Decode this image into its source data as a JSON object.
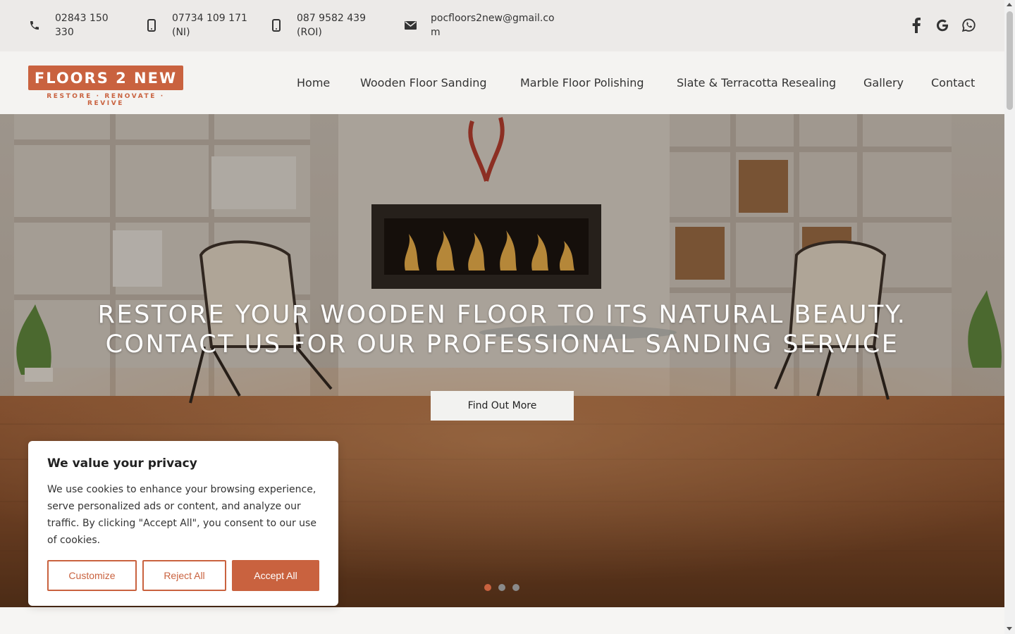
{
  "contact_bar": {
    "phone_landline": "02843 150 330",
    "mobile_ni": "07734 109 171 (NI)",
    "mobile_roi": "087 9582 439 (ROI)",
    "email": "pocfloors2new@gmail.com",
    "icons": [
      "phone-icon",
      "mobile-icon",
      "mobile-icon",
      "mail-icon"
    ],
    "social": [
      "facebook-icon",
      "google-icon",
      "whatsapp-icon"
    ]
  },
  "header": {
    "logo_text": "FLOORS 2 NEW",
    "logo_tagline": "RESTORE · RENOVATE · REVIVE",
    "nav": [
      "Home",
      "Wooden Floor Sanding",
      "Marble Floor Polishing",
      "Slate & Terracotta Resealing",
      "Gallery",
      "Contact"
    ]
  },
  "hero": {
    "title_line1": "RESTORE YOUR WOODEN FLOOR TO ITS NATURAL BEAUTY.",
    "title_line2": "CONTACT US FOR OUR PROFESSIONAL SANDING SERVICE",
    "button": "Find Out More",
    "slides": 3,
    "active_slide": 1
  },
  "cookie_banner": {
    "title": "We value your privacy",
    "text": "We use cookies to enhance your browsing experience, serve personalized ads or content, and analyze our traffic. By clicking \"Accept All\", you consent to our use of cookies.",
    "customize": "Customize",
    "reject": "Reject All",
    "accept": "Accept All"
  },
  "colors": {
    "brand": "#c9623f",
    "topbar_bg": "#eceae8",
    "header_bg": "#f4f3f1"
  }
}
